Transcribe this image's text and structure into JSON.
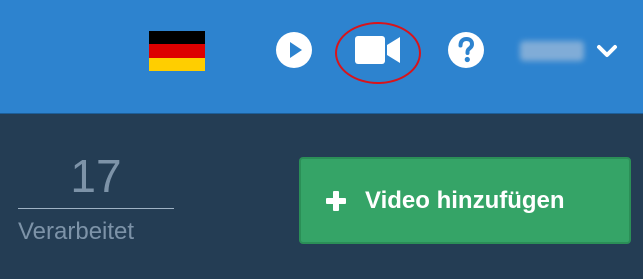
{
  "header": {
    "language_flag": {
      "icon": "germany-flag-icon",
      "colors": [
        "#000000",
        "#dd0000",
        "#ffce00"
      ]
    },
    "play_icon": "play-circle-icon",
    "video_icon": "video-camera-icon",
    "help_icon": "question-circle-icon",
    "user": {
      "name": "████",
      "chevron_icon": "chevron-down-icon"
    },
    "highlight_color": "#d8141b"
  },
  "stats": {
    "processed_value": "17",
    "processed_label": "Verarbeitet"
  },
  "add_video_button": {
    "label": "Video hinzufügen",
    "icon": "plus-icon",
    "color": "#35a467"
  },
  "colors": {
    "topbar": "#2d83cf",
    "background": "#243d54"
  }
}
